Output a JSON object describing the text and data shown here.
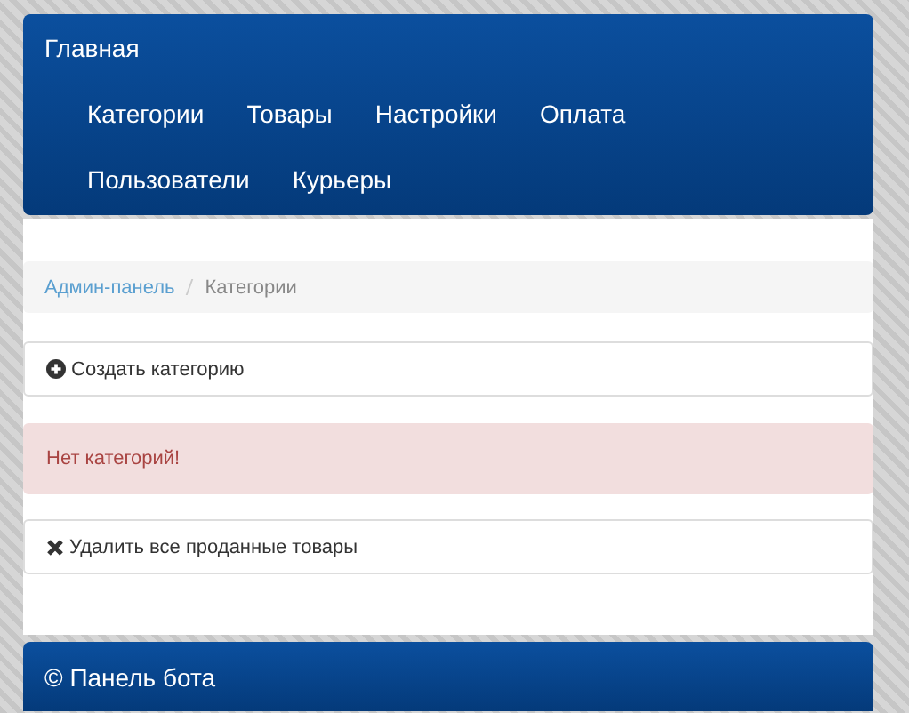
{
  "navbar": {
    "brand": "Главная",
    "items": [
      {
        "label": "Категории"
      },
      {
        "label": "Товары"
      },
      {
        "label": "Настройки"
      },
      {
        "label": "Оплата"
      },
      {
        "label": "Пользователи"
      },
      {
        "label": "Курьеры"
      }
    ]
  },
  "breadcrumb": [
    {
      "label": "Админ-панель",
      "kind": "link"
    },
    {
      "label": "Категории",
      "kind": "current"
    }
  ],
  "actions": [
    {
      "label": "Создать категорию",
      "kind": "create"
    }
  ],
  "alert": "Нет категорий!",
  "bottom_actions": [
    {
      "label": "Удалить все проданные товары",
      "kind": "delete"
    }
  ],
  "footer": "© Панель бота"
}
